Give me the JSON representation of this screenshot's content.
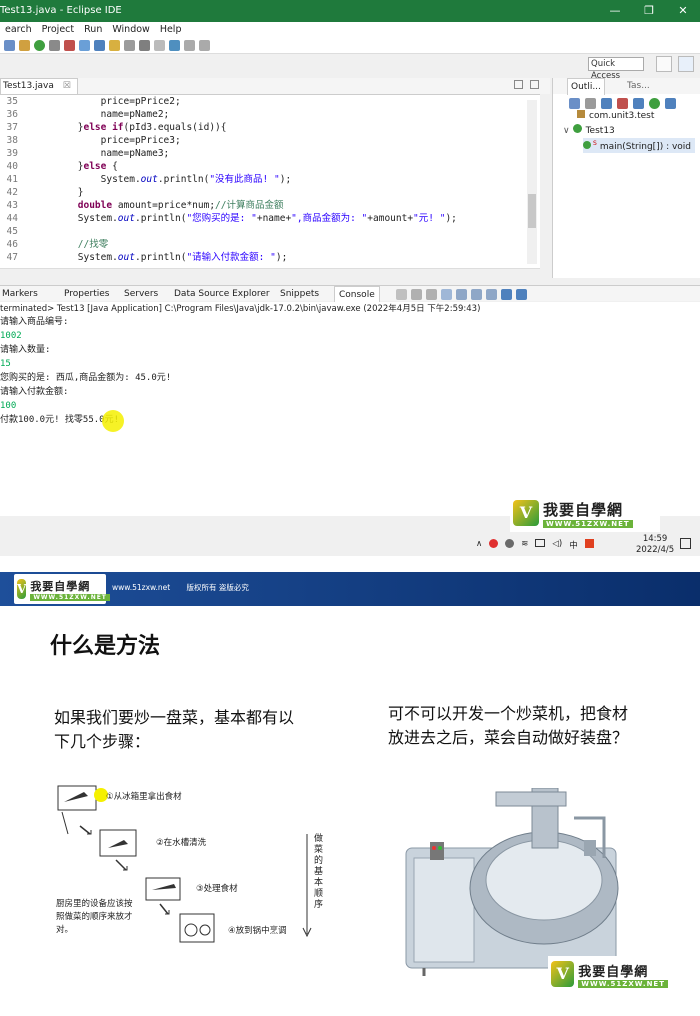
{
  "window": {
    "title": "Test13.java - Eclipse IDE",
    "controls": [
      "—",
      "❐",
      "✕"
    ]
  },
  "menubar": [
    "earch",
    "Project",
    "Run",
    "Window",
    "Help"
  ],
  "quick_access": "Quick Access",
  "editor": {
    "tab_label": "Test13.java",
    "tab_close": "☒",
    "lines": [
      {
        "n": "35",
        "code": "            price=pPrice2;"
      },
      {
        "n": "36",
        "code": "            name=pName2;"
      },
      {
        "n": "37",
        "code": "        }else if(pId3.equals(id)){"
      },
      {
        "n": "38",
        "code": "            price=pPrice3;"
      },
      {
        "n": "39",
        "code": "            name=pName3;"
      },
      {
        "n": "40",
        "code": "        }else {"
      },
      {
        "n": "41",
        "code": "            System.out.println(\"没有此商品! \");"
      },
      {
        "n": "42",
        "code": "        }"
      },
      {
        "n": "43",
        "code": "        double amount=price*num;//计算商品金额"
      },
      {
        "n": "44",
        "code": "        System.out.println(\"您购买的是: \"+name+\",商品金额为: \"+amount+\"元! \");"
      },
      {
        "n": "45",
        "code": ""
      },
      {
        "n": "46",
        "code": "        //找零"
      },
      {
        "n": "47",
        "code": "        System.out.println(\"请输入付款金额: \");"
      }
    ]
  },
  "outline": {
    "tab_outline": "Outli...",
    "tab_tasks": "Tas...",
    "items": [
      "com.unit3.test",
      "Test13",
      "main(String[]) : void"
    ],
    "main_modifier": "S"
  },
  "console_tabs": [
    "Markers",
    "Properties",
    "Servers",
    "Data Source Explorer",
    "Snippets",
    "Console"
  ],
  "console": {
    "header": "terminated> Test13 [Java Application] C:\\Program Files\\Java\\jdk-17.0.2\\bin\\javaw.exe  (2022年4月5日 下午2:59:43)",
    "lines": [
      {
        "text": "请输入商品编号:",
        "input": false
      },
      {
        "text": "1002",
        "input": true
      },
      {
        "text": "请输入数量:",
        "input": false
      },
      {
        "text": "15",
        "input": true
      },
      {
        "text": "您购买的是: 西瓜,商品金额为: 45.0元!",
        "input": false
      },
      {
        "text": "请输入付款金额:",
        "input": false
      },
      {
        "text": "100",
        "input": true
      },
      {
        "text": "付款100.0元! 找零55.0元!",
        "input": false
      }
    ]
  },
  "tray": {
    "time": "14:59",
    "date": "2022/4/5"
  },
  "watermark": {
    "main": "我要自學網",
    "url": "WWW.51ZXW.NET"
  },
  "slide": {
    "banner_url": "www.51zxw.net",
    "banner_notice": "版权所有 盗版必究",
    "title": "什么是方法",
    "left_text": "如果我们要炒一盘菜，基本都有以下几个步骤：",
    "right_text": "可不可以开发一个炒菜机，把食材放进去之后，菜会自动做好装盘？",
    "steps": [
      "①从冰箱里拿出食材",
      "②在水槽清洗",
      "③处理食材",
      "④放到锅中烹调"
    ],
    "side_note": "厨房里的设备应该按照做菜的顺序来放才对。",
    "vertical_label": "做菜的基本顺序"
  }
}
